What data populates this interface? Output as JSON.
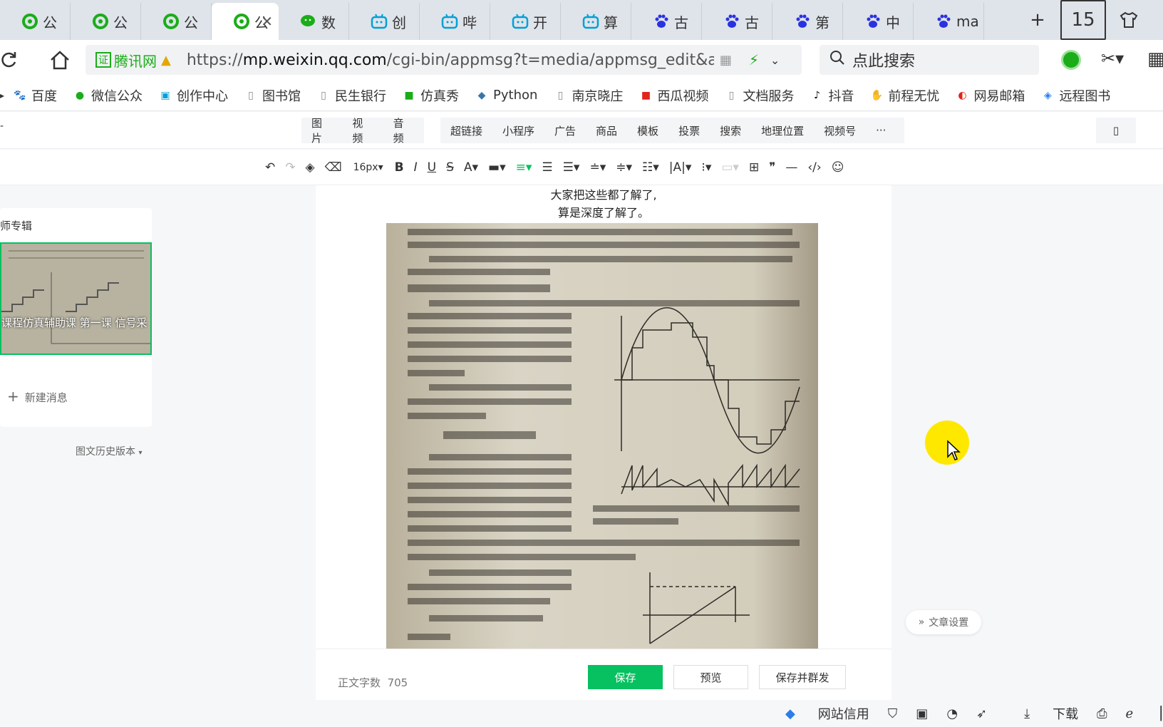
{
  "tabs": [
    {
      "label": "公",
      "icon": "qq-wechat-green-icon"
    },
    {
      "label": "公",
      "icon": "qq-wechat-green-icon"
    },
    {
      "label": "公",
      "icon": "qq-wechat-green-icon"
    },
    {
      "label": "公",
      "icon": "qq-wechat-green-icon",
      "active": true
    },
    {
      "label": "数",
      "icon": "wechat-icon"
    },
    {
      "label": "创",
      "icon": "bilibili-icon"
    },
    {
      "label": "哔",
      "icon": "bilibili-icon"
    },
    {
      "label": "开",
      "icon": "bilibili-icon"
    },
    {
      "label": "算",
      "icon": "bilibili-icon"
    },
    {
      "label": "古",
      "icon": "baidu-paw-icon"
    },
    {
      "label": "古",
      "icon": "baidu-paw-icon"
    },
    {
      "label": "第",
      "icon": "baidu-paw-icon"
    },
    {
      "label": "中",
      "icon": "baidu-paw-icon"
    },
    {
      "label": "ma",
      "icon": "baidu-paw-icon"
    }
  ],
  "tab_counter": "15",
  "address": {
    "cert_label": "腾讯网",
    "url_prefix": "https://",
    "url_host": "mp.weixin.qq.com",
    "url_path": "/cgi-bin/appmsg?t=media/appmsg_edit&actio",
    "search_placeholder": "点此搜索"
  },
  "bookmarks": [
    {
      "label": "百度",
      "icon": "baidu-paw-icon"
    },
    {
      "label": "微信公众",
      "icon": "wechat-icon"
    },
    {
      "label": "创作中心",
      "icon": "bilibili-icon"
    },
    {
      "label": "图书馆",
      "icon": "page-icon"
    },
    {
      "label": "民生银行",
      "icon": "page-icon"
    },
    {
      "label": "仿真秀",
      "icon": "fangzhenxiu-icon"
    },
    {
      "label": "Python",
      "icon": "python-icon"
    },
    {
      "label": "南京晓庄",
      "icon": "page-icon"
    },
    {
      "label": "西瓜视频",
      "icon": "toutiao-icon"
    },
    {
      "label": "文档服务",
      "icon": "page-icon"
    },
    {
      "label": "抖音",
      "icon": "douyin-icon"
    },
    {
      "label": "前程无忧",
      "icon": "hand-icon"
    },
    {
      "label": "网易邮箱",
      "icon": "netease-icon"
    },
    {
      "label": "远程图书",
      "icon": "remote-library-icon"
    }
  ],
  "insert_toolbar": {
    "media": [
      "图片",
      "视频",
      "音频"
    ],
    "tools": [
      "超链接",
      "小程序",
      "广告",
      "商品",
      "模板",
      "投票",
      "搜索",
      "地理位置",
      "视频号"
    ],
    "more": "···"
  },
  "format_toolbar": {
    "font_size": "16px"
  },
  "sidebar": {
    "title": "师专辑",
    "thumb_caption": "课程仿真辅助课 第一课 信号采",
    "new_message": "新建消息",
    "history": "图文历史版本"
  },
  "editor": {
    "caption_line1": "大家把这些都了解了,",
    "caption_line2": "算是深度了解了。"
  },
  "footer": {
    "word_count_label": "正文字数",
    "word_count": "705",
    "save": "保存",
    "preview": "预览",
    "save_send": "保存并群发"
  },
  "article_settings": "文章设置",
  "statusbar": {
    "site_credit": "网站信用",
    "download": "下载"
  },
  "colors": {
    "accent": "#07c160",
    "tabbar": "#dfe3ea"
  }
}
